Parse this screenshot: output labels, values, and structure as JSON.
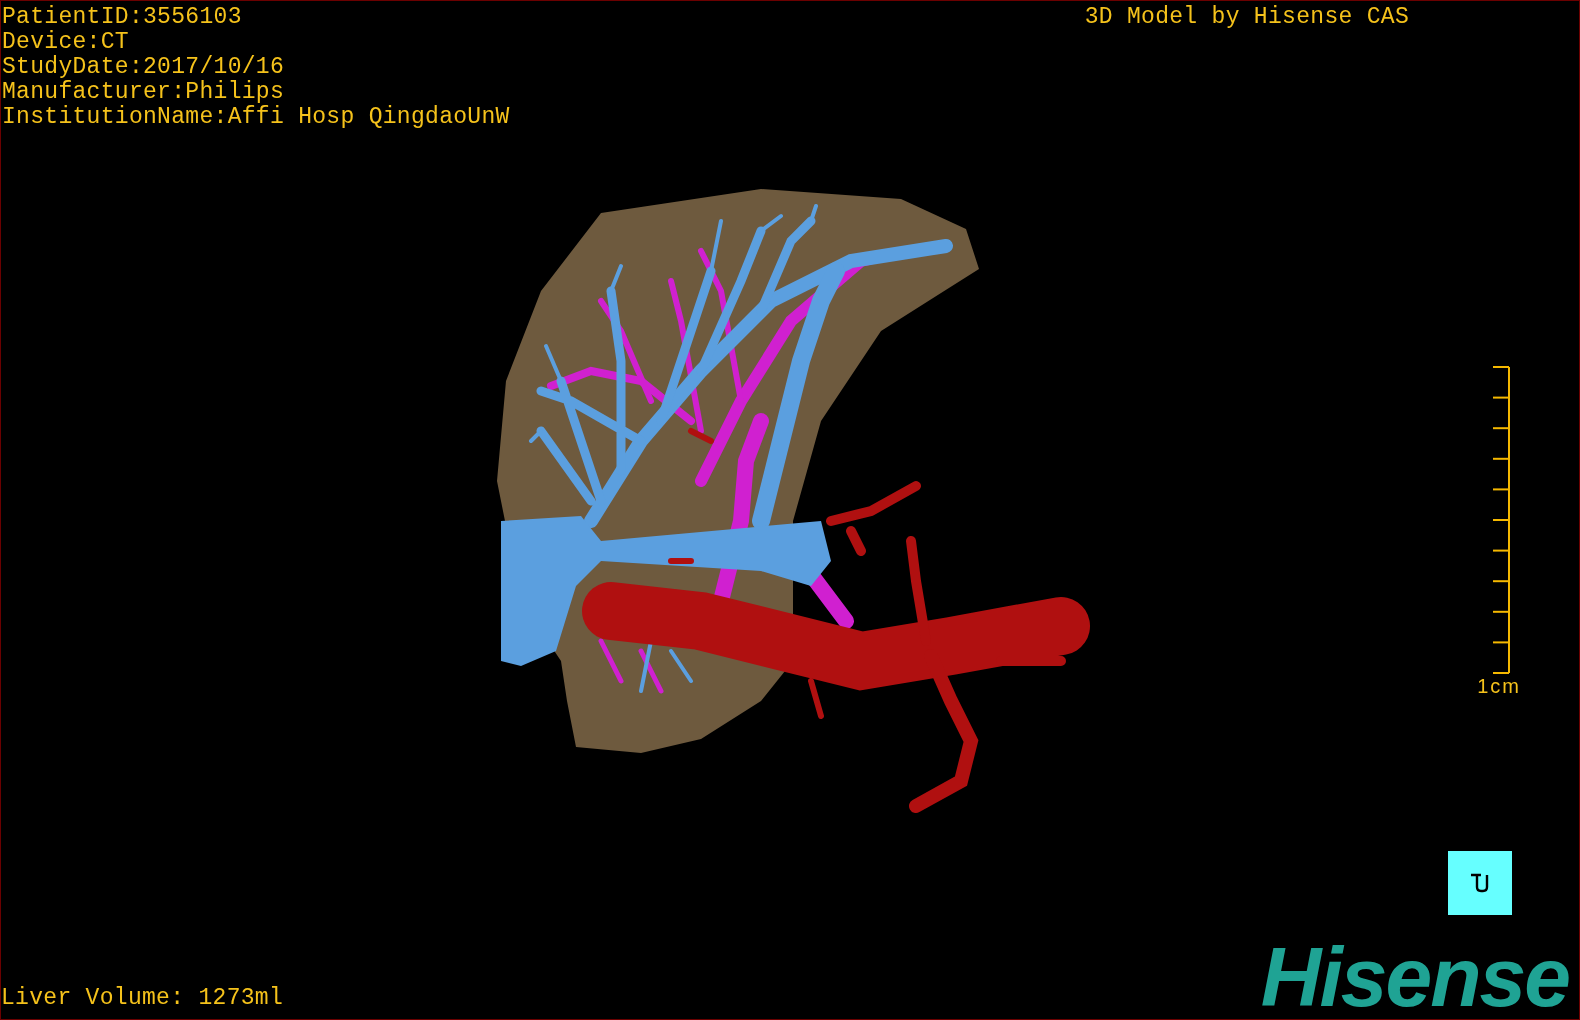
{
  "patient_info": [
    "PatientID:3556103",
    "Device:CT",
    "StudyDate:2017/10/16",
    "Manufacturer:Philips",
    "InstitutionName:Affi Hosp QingdaoUnW"
  ],
  "model_credit": "3D Model by Hisense CAS",
  "scale_bar": {
    "label": "1cm"
  },
  "liver_volume": "Liver Volume: 1273ml",
  "logo": "Hisense"
}
